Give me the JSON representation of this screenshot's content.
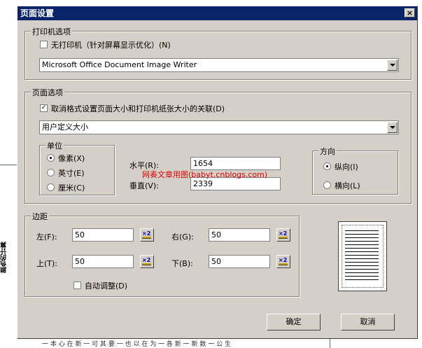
{
  "dialog": {
    "title": "页面设置",
    "close_glyph": "×"
  },
  "printer": {
    "legend": "打印机选项",
    "no_printer_label": "无打印机（针对屏幕显示优化）(N)",
    "no_printer_checked": false,
    "printer_select": "Microsoft Office Document Image Writer"
  },
  "page": {
    "legend": "页面选项",
    "decouple_label": "取消格式设置页面大小和打印机纸张大小的关联(D)",
    "decouple_checked": true,
    "size_select": "用户定义大小",
    "unit": {
      "legend": "单位",
      "options": [
        "像素(X)",
        "英寸(E)",
        "厘米(C)"
      ],
      "selected": 0
    },
    "width_label": "水平(R):",
    "width_value": "1654",
    "height_label": "垂直(V):",
    "height_value": "2339",
    "orientation": {
      "legend": "方向",
      "options": [
        "纵向(I)",
        "横向(L)"
      ],
      "selected": 0
    }
  },
  "margins": {
    "legend": "边距",
    "left_label": "左(F):",
    "left_value": "50",
    "right_label": "右(G):",
    "right_value": "50",
    "top_label": "上(T):",
    "top_value": "50",
    "bottom_label": "下(B):",
    "bottom_value": "50",
    "auto_label": "自动调整(D)",
    "auto_checked": false
  },
  "buttons": {
    "ok": "确定",
    "cancel": "取消"
  },
  "watermark": "网奏文章用图(babyt.cnblogs.com)",
  "background": {
    "vertical_text": "颜色的计算",
    "bottom_text": "一 本 心 在 新 一 可 其 要 一 也 以 在 为 一 各 新 一 新 数 一 公 生"
  },
  "colors": {
    "title_bar": "#0a246a",
    "dialog_face": "#d4d0c8",
    "watermark": "#e00000"
  }
}
